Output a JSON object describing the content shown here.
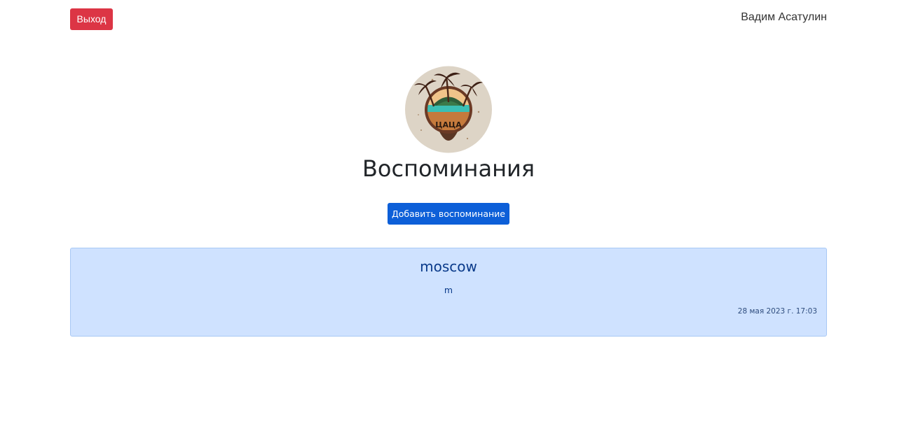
{
  "header": {
    "logout_label": "Выход",
    "user_name": "Вадим Асатулин"
  },
  "logo": {
    "icon": "tropical-island-logo-icon",
    "logo_text": "ЦАЦА"
  },
  "main": {
    "title": "Воспоминания",
    "add_button_label": "Добавить воспоминание"
  },
  "memories": [
    {
      "title": "moscow",
      "text": "m",
      "date": "28 мая 2023 г. 17:03"
    }
  ],
  "colors": {
    "logout": "#dc3545",
    "primary": "#0d5fd8",
    "card_background": "#cfe2ff",
    "card_text": "#0a3a8a"
  }
}
